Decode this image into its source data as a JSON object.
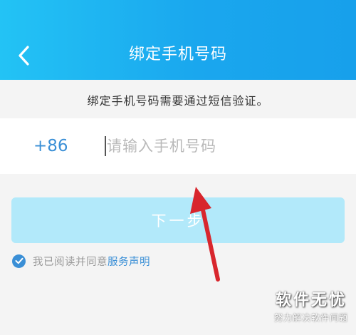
{
  "header": {
    "title": "绑定手机号码",
    "back_icon": "chevron-left-icon"
  },
  "notice": "绑定手机号码需要通过短信验证。",
  "phone": {
    "country_code": "+86",
    "placeholder": "请输入手机号码",
    "value": ""
  },
  "next_button": {
    "label": "下一步"
  },
  "agreement": {
    "checked": true,
    "text": "我已阅读并同意",
    "link": "服务声明"
  },
  "watermark": {
    "title": "软件无忧",
    "subtitle": "努力解决软件问题"
  },
  "colors": {
    "header_start": "#23c3f5",
    "header_end": "#17a0eb",
    "accent": "#3a8fd6",
    "button_disabled": "#b2e9fa",
    "arrow": "#d8262d"
  }
}
